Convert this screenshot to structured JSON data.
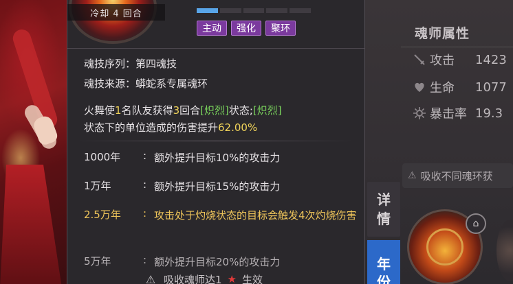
{
  "skill": {
    "cooldown": "冷却 4 回合",
    "tags": [
      "主动",
      "强化",
      "聚环"
    ],
    "progress": {
      "active_segments": 1,
      "total_segments": 5
    }
  },
  "info": {
    "order": "魂技序列：第四魂技",
    "source": "魂技来源：蟒蛇系专属魂环"
  },
  "description": {
    "p1": "火舞使",
    "n1": "1",
    "p2": "名队友获得",
    "n2": "3",
    "p3": "回合",
    "s1": "[炽烈]",
    "p4": "状态;",
    "s2": "[炽烈]",
    "p5": "状态下的单位造成的伤害提升",
    "pct": "62.00%"
  },
  "year_bonuses": [
    {
      "year": "1000年",
      "colon": ":",
      "text": "额外提升目标10%的攻击力"
    },
    {
      "year": "1万年",
      "colon": ":",
      "text": "额外提升目标15%的攻击力"
    },
    {
      "year": "2.5万年",
      "colon": ":",
      "text": "攻击处于灼烧状态的目标会触发4次灼烧伤害"
    },
    {
      "year": "5万年",
      "colon": ":",
      "text": "额外提升目标20%的攻击力"
    }
  ],
  "bottom_note": {
    "prefix": "吸收魂师达1",
    "suffix": "生效"
  },
  "attributes": {
    "title": "魂师属性",
    "rows": [
      {
        "icon": "sword-icon",
        "name": "攻击",
        "value": "1423"
      },
      {
        "icon": "heart-icon",
        "name": "生命",
        "value": "1077"
      },
      {
        "icon": "burst-icon",
        "name": "暴击率",
        "value": "19.3"
      }
    ]
  },
  "absorb_hint": "吸收不同魂环获",
  "side_tabs": {
    "detail": [
      "详",
      "情"
    ],
    "age": [
      "年",
      "份"
    ]
  },
  "colors": {
    "tag_purple": "#7b3a9e",
    "highlight_green": "#7bd65d",
    "highlight_yellow": "#f0d35a",
    "gold_row": "#efc55a",
    "tab_blue": "#2c69c9",
    "progress_blue": "#59a5e8"
  }
}
